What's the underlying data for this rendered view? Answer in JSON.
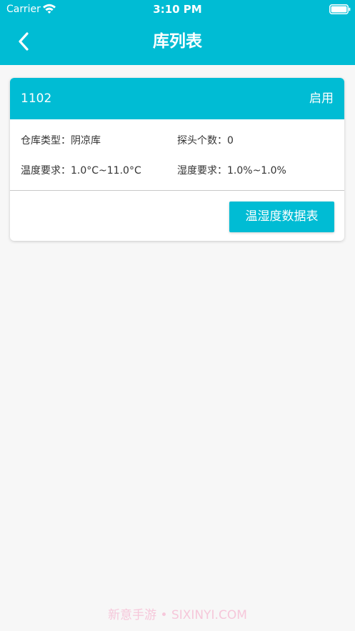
{
  "status_bar": {
    "carrier": "Carrier",
    "time": "3:10 PM",
    "wifi_icon": "wifi-icon",
    "battery_icon": "battery-icon"
  },
  "nav": {
    "back_icon": "chevron-left-icon",
    "title": "库列表"
  },
  "warehouse": {
    "id": "1102",
    "status": "启用",
    "type_text": "仓库类型：阴凉库",
    "probe_text": "探头个数：0",
    "temperature_text": "温度要求：1.0°C~11.0°C",
    "humidity_text": "湿度要求：1.0%~1.0%",
    "data_button": "温湿度数据表"
  },
  "watermark": "新意手游 • SIXINYI.COM",
  "colors": {
    "accent": "#00bcd4",
    "background": "#f7f7f7",
    "card": "#ffffff",
    "text": "#333333",
    "watermark": "#f6c7da"
  }
}
